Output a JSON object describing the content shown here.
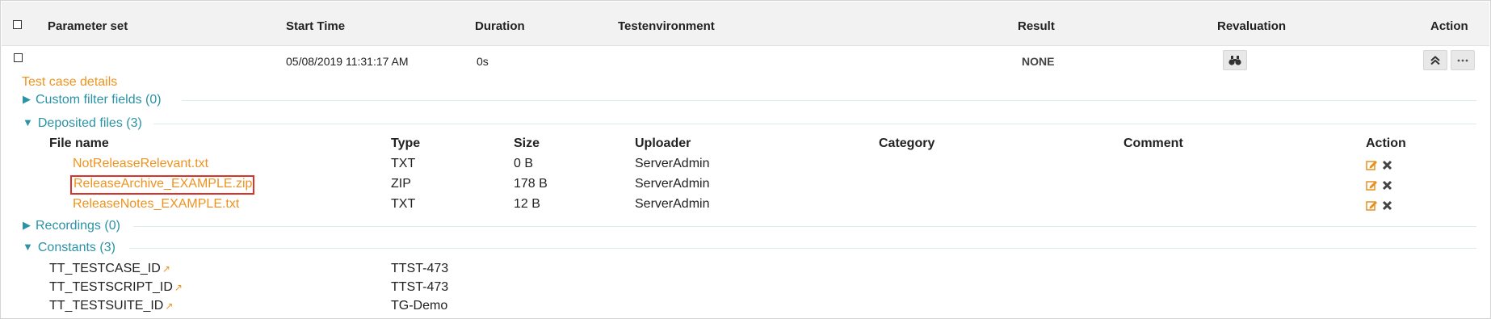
{
  "table_header": {
    "parameter_set": "Parameter set",
    "start_time": "Start Time",
    "duration": "Duration",
    "testenvironment": "Testenvironment",
    "result": "Result",
    "revaluation": "Revaluation",
    "action": "Action"
  },
  "row": {
    "start_time": "05/08/2019 11:31:17 AM",
    "duration": "0s",
    "result": "NONE"
  },
  "details": {
    "title": "Test case details",
    "custom_filter": "Custom filter fields (0)",
    "deposited_files": "Deposited files (3)",
    "recordings": "Recordings (0)",
    "constants": "Constants (3)"
  },
  "files": {
    "headers": {
      "name": "File name",
      "type": "Type",
      "size": "Size",
      "uploader": "Uploader",
      "category": "Category",
      "comment": "Comment",
      "action": "Action"
    },
    "rows": [
      {
        "name": "NotReleaseRelevant.txt",
        "type": "TXT",
        "size": "0 B",
        "uploader": "ServerAdmin"
      },
      {
        "name": "ReleaseArchive_EXAMPLE.zip",
        "type": "ZIP",
        "size": "178 B",
        "uploader": "ServerAdmin"
      },
      {
        "name": "ReleaseNotes_EXAMPLE.txt",
        "type": "TXT",
        "size": "12 B",
        "uploader": "ServerAdmin"
      }
    ]
  },
  "constants": [
    {
      "key": "TT_TESTCASE_ID",
      "value": "TTST-473"
    },
    {
      "key": "TT_TESTSCRIPT_ID",
      "value": "TTST-473"
    },
    {
      "key": "TT_TESTSUITE_ID",
      "value": "TG-Demo"
    }
  ],
  "colors": {
    "link_orange": "#f0931e",
    "section_teal": "#2a93a6",
    "highlight_red": "#d9342b"
  },
  "icons": [
    "binoculars-icon",
    "collapse-up-icon",
    "more-options-icon",
    "edit-icon",
    "delete-icon",
    "external-link-icon",
    "triangle-right-icon",
    "triangle-down-icon"
  ]
}
